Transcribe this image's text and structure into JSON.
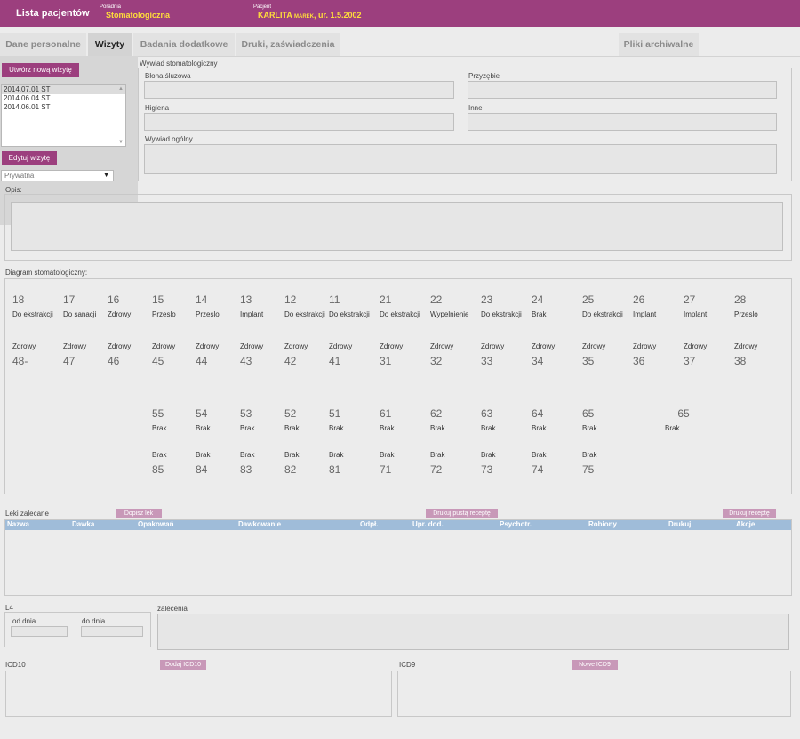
{
  "header": {
    "patients_link": "Lista pacjentów",
    "clinic_label": "Poradnia",
    "clinic_name": "Stomatologiczna",
    "patient_label": "Pacjent",
    "patient_last": "KARLITA",
    "patient_first": "MAREK",
    "patient_dob": ", ur. 1.5.2002"
  },
  "tabs": [
    {
      "label": "Dane personalne",
      "active": false
    },
    {
      "label": "Wizyty",
      "active": true
    },
    {
      "label": "Badania dodatkowe",
      "active": false
    },
    {
      "label": "Druki, zaświadczenia",
      "active": false
    },
    {
      "label": "Pliki archiwalne",
      "active": false
    }
  ],
  "visits": {
    "new_visit_btn": "Utwórz nową wizytę",
    "list": [
      "2014.07.01  ST",
      "2014.06.04  ST",
      "2014.06.01  ST"
    ],
    "edit_visit_btn": "Edytuj wizytę",
    "payment_select": "Prywatna"
  },
  "interview": {
    "title": "Wywiad stomatologiczny",
    "mucosa": "Błona śluzowa",
    "gums": "Przyzębie",
    "hygiene": "Higiena",
    "other": "Inne",
    "general": "Wywiad ogólny"
  },
  "description_label": "Opis:",
  "diagram": {
    "title": "Diagram stomatologiczny:",
    "upper": [
      {
        "num": "18",
        "status": "Do ekstrakcji"
      },
      {
        "num": "17",
        "status": "Do sanacji"
      },
      {
        "num": "16",
        "status": "Zdrowy"
      },
      {
        "num": "15",
        "status": "Przeslo"
      },
      {
        "num": "14",
        "status": "Przeslo"
      },
      {
        "num": "13",
        "status": "Implant"
      },
      {
        "num": "12",
        "status": "Do ekstrakcji"
      },
      {
        "num": "11",
        "status": "Do ekstrakcji"
      },
      {
        "num": "21",
        "status": "Do ekstrakcji"
      },
      {
        "num": "22",
        "status": "Wypelnienie"
      },
      {
        "num": "23",
        "status": "Do ekstrakcji"
      },
      {
        "num": "24",
        "status": "Brak"
      },
      {
        "num": "25",
        "status": "Do ekstrakcji"
      },
      {
        "num": "26",
        "status": "Implant"
      },
      {
        "num": "27",
        "status": "Implant"
      },
      {
        "num": "28",
        "status": "Przeslo"
      }
    ],
    "lower": [
      {
        "num": "48-",
        "status": "Zdrowy"
      },
      {
        "num": "47",
        "status": "Zdrowy"
      },
      {
        "num": "46",
        "status": "Zdrowy"
      },
      {
        "num": "45",
        "status": "Zdrowy"
      },
      {
        "num": "44",
        "status": "Zdrowy"
      },
      {
        "num": "43",
        "status": "Zdrowy"
      },
      {
        "num": "42",
        "status": "Zdrowy"
      },
      {
        "num": "41",
        "status": "Zdrowy"
      },
      {
        "num": "31",
        "status": "Zdrowy"
      },
      {
        "num": "32",
        "status": "Zdrowy"
      },
      {
        "num": "33",
        "status": "Zdrowy"
      },
      {
        "num": "34",
        "status": "Zdrowy"
      },
      {
        "num": "35",
        "status": "Zdrowy"
      },
      {
        "num": "36",
        "status": "Zdrowy"
      },
      {
        "num": "37",
        "status": "Zdrowy"
      },
      {
        "num": "38",
        "status": "Zdrowy"
      }
    ],
    "milk_upper": [
      {
        "num": "55",
        "status": "Brak"
      },
      {
        "num": "54",
        "status": "Brak"
      },
      {
        "num": "53",
        "status": "Brak"
      },
      {
        "num": "52",
        "status": "Brak"
      },
      {
        "num": "51",
        "status": "Brak"
      },
      {
        "num": "61",
        "status": "Brak"
      },
      {
        "num": "62",
        "status": "Brak"
      },
      {
        "num": "63",
        "status": "Brak"
      },
      {
        "num": "64",
        "status": "Brak"
      },
      {
        "num": "65",
        "status": "Brak"
      },
      {
        "num": "65",
        "status": "Brak"
      }
    ],
    "milk_lower": [
      {
        "num": "85",
        "status": "Brak"
      },
      {
        "num": "84",
        "status": "Brak"
      },
      {
        "num": "83",
        "status": "Brak"
      },
      {
        "num": "82",
        "status": "Brak"
      },
      {
        "num": "81",
        "status": "Brak"
      },
      {
        "num": "71",
        "status": "Brak"
      },
      {
        "num": "72",
        "status": "Brak"
      },
      {
        "num": "73",
        "status": "Brak"
      },
      {
        "num": "74",
        "status": "Brak"
      },
      {
        "num": "75",
        "status": "Brak"
      }
    ]
  },
  "meds": {
    "title": "Leki zalecane",
    "add_btn": "Dopisz lek",
    "print_empty_btn": "Drukuj pustą receptę",
    "print_btn": "Drukuj receptę",
    "columns": [
      "Nazwa",
      "Dawka",
      "Opakowań",
      "Dawkowanie",
      "Odpł.",
      "Upr. dod.",
      "Psychotr.",
      "Robiony",
      "Drukuj",
      "Akcje"
    ]
  },
  "l4": {
    "title": "L4",
    "from_label": "od dnia",
    "to_label": "do dnia"
  },
  "recommendations_label": "zalecenia",
  "icd10": {
    "title": "ICD10",
    "btn": "Dodaj ICD10"
  },
  "icd9": {
    "title": "ICD9",
    "btn": "Nowe ICD9"
  }
}
